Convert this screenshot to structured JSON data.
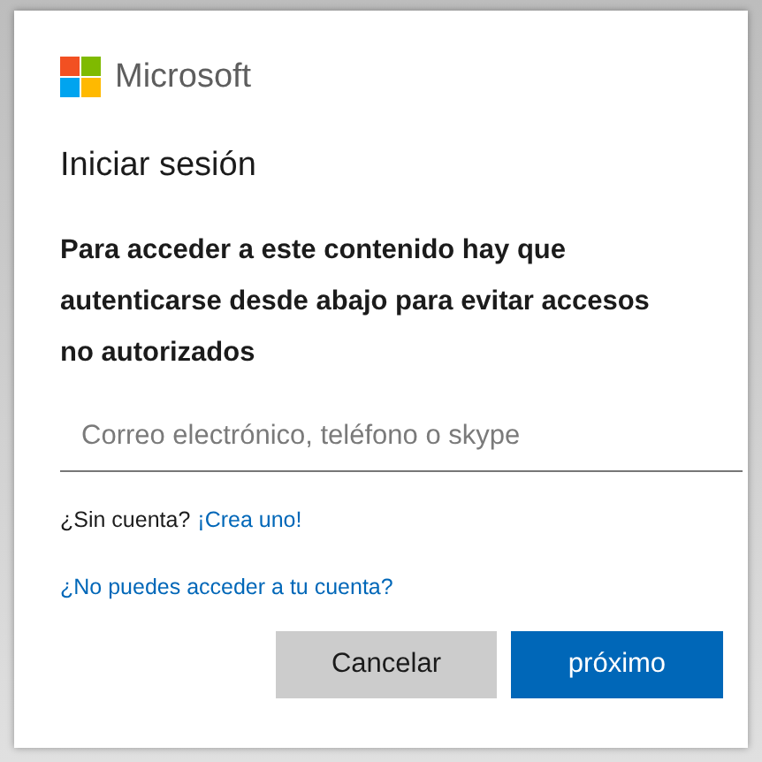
{
  "brand": {
    "name": "Microsoft"
  },
  "title": "Iniciar sesión",
  "message": "Para acceder a este contenido hay que autenticarse desde abajo para evitar accesos no autorizados",
  "email_field": {
    "placeholder": "Correo electrónico, teléfono o skype"
  },
  "no_account": {
    "text": "¿Sin cuenta?",
    "link": "¡Crea uno!"
  },
  "help_link": "¿No puedes acceder a tu cuenta?",
  "buttons": [
    {
      "label": "Cancelar",
      "kind": "secondary"
    },
    {
      "label": "próximo",
      "kind": "primary"
    }
  ]
}
